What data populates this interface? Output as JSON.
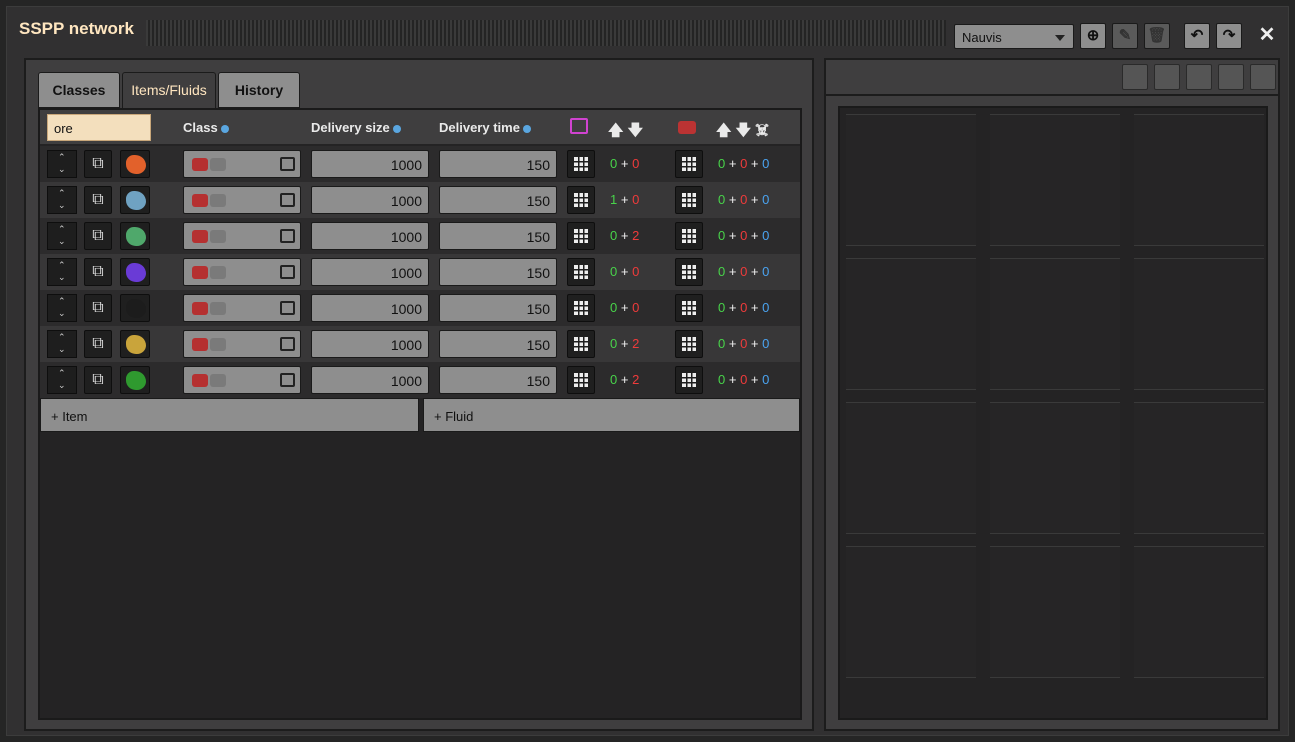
{
  "title": "SSPP network",
  "surface": "Nauvis",
  "tabs": [
    "Classes",
    "Items/Fluids",
    "History"
  ],
  "search": "ore",
  "headers": {
    "class": "Class",
    "delivery_size": "Delivery size",
    "delivery_time": "Delivery time"
  },
  "rows": [
    {
      "ore": "copper-ore-icon",
      "color": "#e2612b",
      "size": "1000",
      "time": "150",
      "prov": [
        "0",
        "0"
      ],
      "req": [
        "0",
        "0",
        "0"
      ]
    },
    {
      "ore": "iron-ore-icon",
      "color": "#6fa2c2",
      "size": "1000",
      "time": "150",
      "prov": [
        "1",
        "0"
      ],
      "req": [
        "0",
        "0",
        "0"
      ]
    },
    {
      "ore": "uranium-ore-icon",
      "color": "#4fa86b",
      "size": "1000",
      "time": "150",
      "prov": [
        "0",
        "2"
      ],
      "req": [
        "0",
        "0",
        "0"
      ]
    },
    {
      "ore": "purple-ore-icon",
      "color": "#6a3bd6",
      "size": "1000",
      "time": "150",
      "prov": [
        "0",
        "0"
      ],
      "req": [
        "0",
        "0",
        "0"
      ]
    },
    {
      "ore": "coal-icon",
      "color": "#1c1c1c",
      "size": "1000",
      "time": "150",
      "prov": [
        "0",
        "0"
      ],
      "req": [
        "0",
        "0",
        "0"
      ]
    },
    {
      "ore": "gold-ore-icon",
      "color": "#c9a43b",
      "size": "1000",
      "time": "150",
      "prov": [
        "0",
        "2"
      ],
      "req": [
        "0",
        "0",
        "0"
      ]
    },
    {
      "ore": "green-ore-icon",
      "color": "#2f9a2f",
      "size": "1000",
      "time": "150",
      "prov": [
        "0",
        "2"
      ],
      "req": [
        "0",
        "0",
        "0"
      ]
    }
  ],
  "add_item": "+ Item",
  "add_fluid": "+ Fluid"
}
